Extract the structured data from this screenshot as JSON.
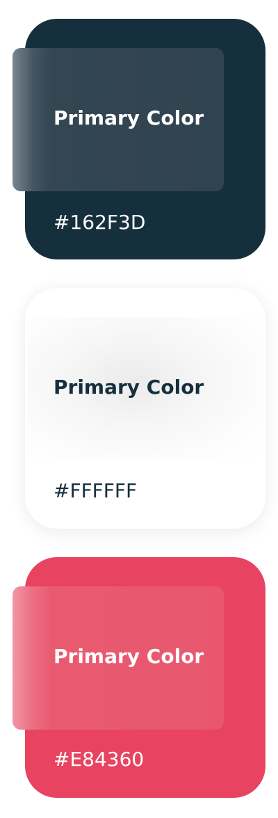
{
  "swatches": [
    {
      "title": "Primary Color",
      "hex_label": "#162F3D",
      "color": "#162F3D",
      "text_color": "#FFFFFF"
    },
    {
      "title": "Primary Color",
      "hex_label": "#FFFFFF",
      "color": "#FFFFFF",
      "text_color": "#162F3D"
    },
    {
      "title": "Primary Color",
      "hex_label": "#E84360",
      "color": "#E84360",
      "text_color": "#FFFFFF"
    }
  ]
}
